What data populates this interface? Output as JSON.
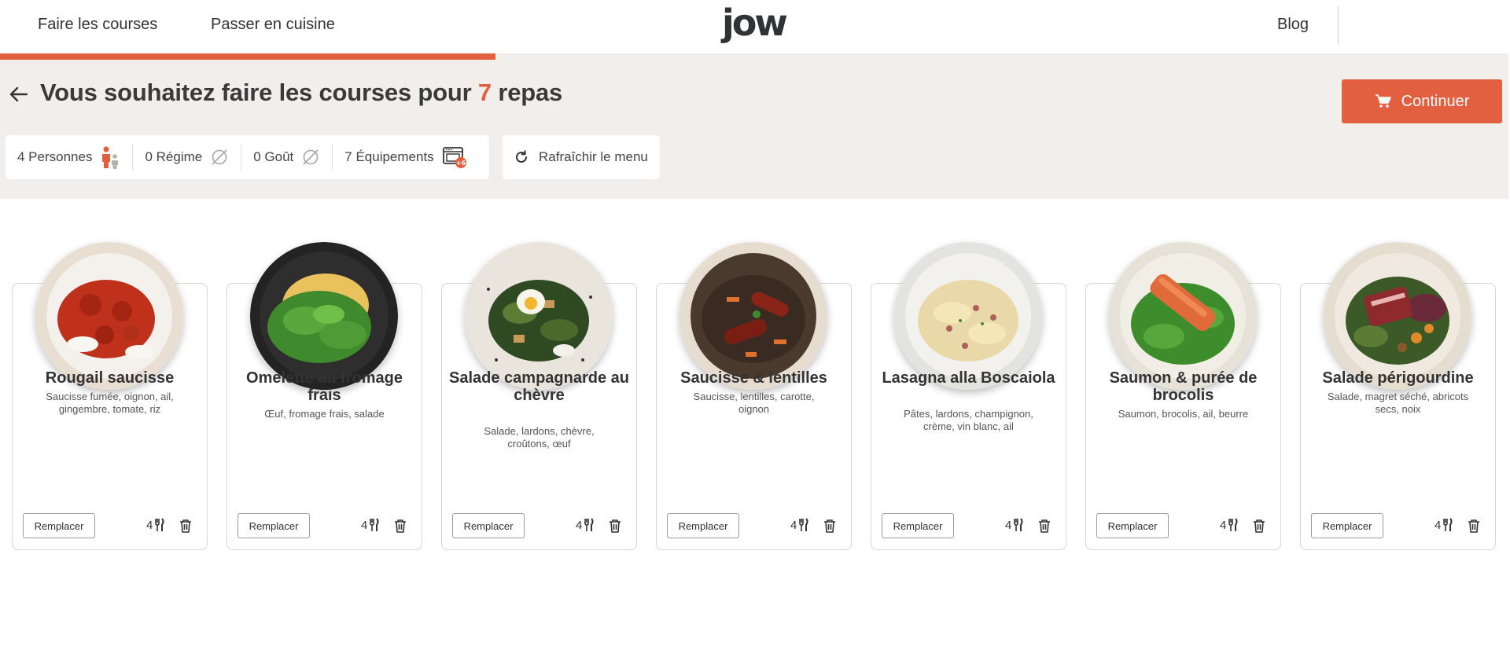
{
  "nav": {
    "links": [
      "Faire les courses",
      "Passer en cuisine"
    ],
    "logo": "jow",
    "blog": "Blog"
  },
  "header": {
    "title_prefix": "Vous souhaitez faire les courses pour",
    "meal_count": "7",
    "title_suffix": "repas",
    "continue_label": "Continuer"
  },
  "filters": {
    "persons": "4 Personnes",
    "diet": "0 Régime",
    "taste": "0 Goût",
    "equipment": "7 Équipements",
    "equipment_badge": "+6",
    "refresh": "Rafraîchir le menu"
  },
  "colors": {
    "accent": "#e2603f",
    "band": "#f1eeeb"
  },
  "recipes": [
    {
      "title": "Rougail saucisse",
      "ingredients": "Saucisse fumée, oignon, ail, gingembre, tomate, riz",
      "servings": "4",
      "replace": "Remplacer"
    },
    {
      "title": "Omelette au fromage frais",
      "ingredients": "Œuf, fromage frais, salade",
      "servings": "4",
      "replace": "Remplacer"
    },
    {
      "title": "Salade campagnarde au chèvre",
      "ingredients": "Salade, lardons, chèvre, croûtons, œuf",
      "servings": "4",
      "replace": "Remplacer"
    },
    {
      "title": "Saucisse & lentilles",
      "ingredients": "Saucisse, lentilles, carotte, oignon",
      "servings": "4",
      "replace": "Remplacer"
    },
    {
      "title": "Lasagna alla Boscaiola",
      "ingredients": "Pâtes, lardons, champignon, crème, vin blanc, ail",
      "servings": "4",
      "replace": "Remplacer"
    },
    {
      "title": "Saumon & purée de brocolis",
      "ingredients": "Saumon, brocolis, ail, beurre",
      "servings": "4",
      "replace": "Remplacer"
    },
    {
      "title": "Salade périgourdine",
      "ingredients": "Salade, magret séché, abricots secs, noix",
      "servings": "4",
      "replace": "Remplacer"
    }
  ]
}
